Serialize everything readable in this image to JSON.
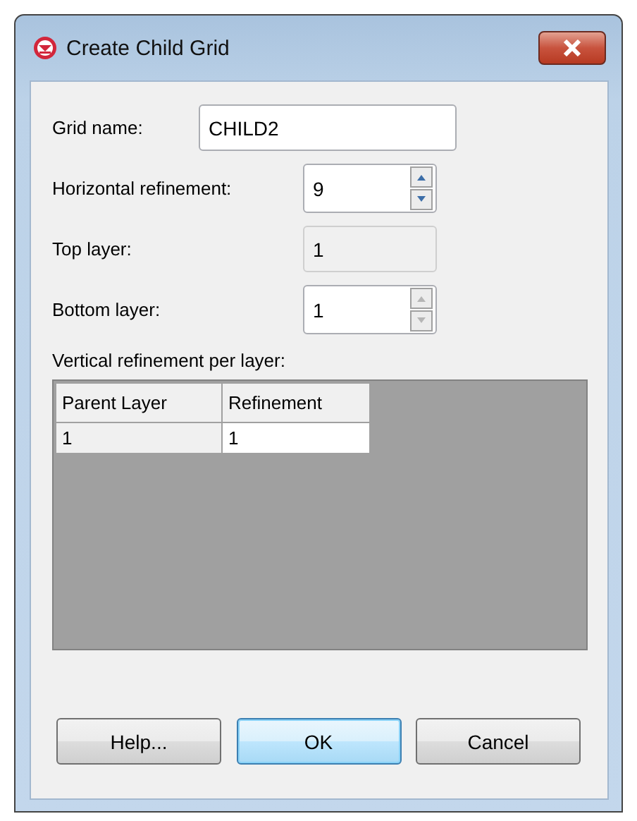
{
  "window": {
    "title": "Create Child Grid"
  },
  "fields": [
    {
      "kind": "text",
      "label": "Grid name:",
      "value": "CHILD2",
      "disabled": false
    },
    {
      "kind": "spin",
      "label": "Horizontal refinement:",
      "value": "9",
      "disabled": false
    },
    {
      "kind": "text",
      "label": "Top layer:",
      "value": "1",
      "disabled": true
    },
    {
      "kind": "spin",
      "label": "Bottom layer:",
      "value": "1",
      "disabled": true
    }
  ],
  "table": {
    "label": "Vertical refinement per layer:",
    "columns": [
      "Parent Layer",
      "Refinement"
    ],
    "rows": [
      [
        "1",
        "1"
      ]
    ]
  },
  "buttons": [
    {
      "label": "Help...",
      "default": false
    },
    {
      "label": "OK",
      "default": true
    },
    {
      "label": "Cancel",
      "default": false
    }
  ]
}
